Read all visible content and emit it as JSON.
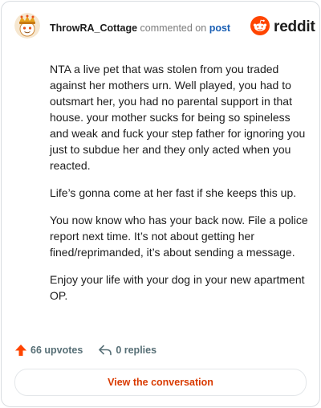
{
  "header": {
    "username": "ThrowRA_Cottage",
    "action_text": "commented on",
    "post_link": "post",
    "avatar_icon": "snoo-avatar-icon",
    "brand": {
      "wordmark": "reddit",
      "icon": "reddit-snoo-icon",
      "color": "#ff4500"
    }
  },
  "comment": {
    "paragraphs": [
      "NTA a live pet that was stolen from you traded against her mothers urn. Well played, you had to outsmart her, you had no parental support in that house. your mother sucks for being so spineless and weak and fuck your step father for ignoring you just to subdue her and they only acted when you reacted.",
      "Life’s gonna come at her fast if she keeps this up.",
      "You now know who has your back now. File a police report next time. It’s not about getting her fined/reprimanded, it’s about sending a message.",
      "Enjoy your life with your dog in your new apartment OP."
    ]
  },
  "footer": {
    "upvotes_label": "66 upvotes",
    "upvote_icon": "upvote-arrow-icon",
    "upvote_color": "#ff4500",
    "replies_label": "0 replies",
    "reply_icon": "reply-arrow-icon"
  },
  "cta": {
    "label": "View the conversation",
    "color": "#d93a00"
  }
}
